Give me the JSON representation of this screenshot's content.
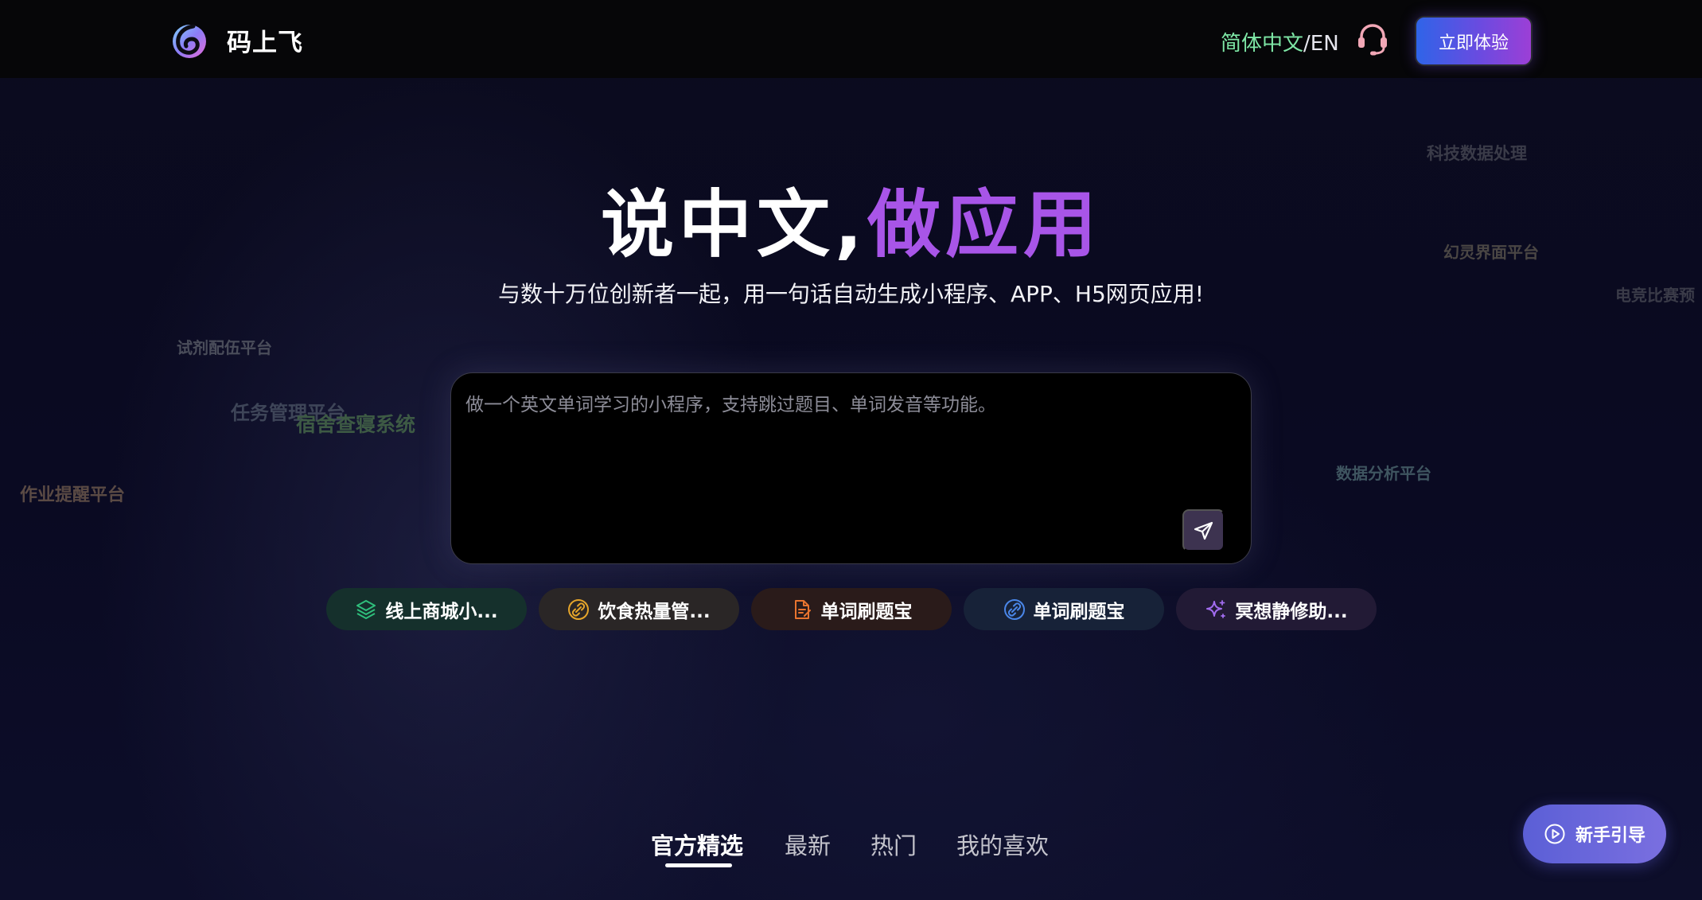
{
  "header": {
    "brand": "码上飞",
    "lang_zh": "简体中文",
    "lang_sep": "/",
    "lang_en": "EN",
    "cta_label": "立即体验"
  },
  "floating_tags": [
    {
      "text": "科技数据处理",
      "color": "#3a3b48"
    },
    {
      "text": "幻灵界面平台",
      "color": "#4a4644"
    },
    {
      "text": "电竞比赛预",
      "color": "#3a3b48"
    },
    {
      "text": "试剂配伍平台",
      "color": "#4a4d5a"
    },
    {
      "text": "任务管理平台",
      "color": "#3e4558"
    },
    {
      "text": "宿舍查寝系统",
      "color": "#3d5a44"
    },
    {
      "text": "作业提醒平台",
      "color": "#5a4a44"
    },
    {
      "text": "数据分析平台",
      "color": "#3f5560"
    }
  ],
  "hero": {
    "title_white": "说中文,",
    "title_purple": "做应用",
    "subtitle": "与数十万位创新者一起，用一句话自动生成小程序、APP、H5网页应用!"
  },
  "prompt": {
    "placeholder": "做一个英文单词学习的小程序，支持跳过题目、单词发音等功能。",
    "value": ""
  },
  "chips": [
    {
      "label": "线上商城小...",
      "icon": "layers-icon",
      "bg": "#15302c",
      "icon_color": "#2fbf7c"
    },
    {
      "label": "饮食热量管...",
      "icon": "link-icon",
      "bg": "#2a2626",
      "icon_color": "#e5a52a"
    },
    {
      "label": "单词刷题宝",
      "icon": "document-icon",
      "bg": "#2a1b1a",
      "icon_color": "#e8742f"
    },
    {
      "label": "单词刷题宝",
      "icon": "link-icon",
      "bg": "#172238",
      "icon_color": "#4a86e8"
    },
    {
      "label": "冥想静修助...",
      "icon": "sparkle-icon",
      "bg": "#221a35",
      "icon_color": "#a26cf0"
    }
  ],
  "tabs": [
    {
      "label": "官方精选",
      "active": true
    },
    {
      "label": "最新",
      "active": false
    },
    {
      "label": "热门",
      "active": false
    },
    {
      "label": "我的喜欢",
      "active": false
    }
  ],
  "guide": {
    "label": "新手引导"
  },
  "colors": {
    "accent_purple": "#a855e8",
    "lang_green": "#7ee7a6",
    "cta_start": "#2f64e8",
    "cta_end": "#9c3fd6"
  }
}
